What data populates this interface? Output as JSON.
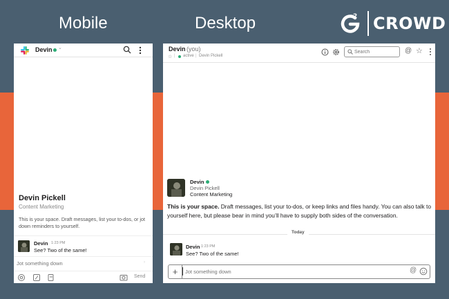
{
  "headings": {
    "mobile": "Mobile",
    "desktop": "Desktop"
  },
  "logo": {
    "text": "CROWD",
    "mark": "G",
    "superscript": "2"
  },
  "mobile": {
    "header": {
      "name": "Devin",
      "chevron": "⌄"
    },
    "intro": {
      "title": "Devin Pickell",
      "subtitle": "Content Marketing",
      "description": "This is your space. Draft messages, list your to-dos, or jot down reminders to yourself."
    },
    "message": {
      "author": "Devin",
      "time": "1:23 PM",
      "text": "See? Two of the same!"
    },
    "composer": {
      "placeholder": "Jot something down",
      "send_label": "Send"
    },
    "toolbar_icons": [
      "at-icon",
      "slash-icon",
      "attachment-icon",
      "image-icon"
    ]
  },
  "desktop": {
    "header": {
      "name": "Devin",
      "you": "(you)",
      "status": "active",
      "fullname": "Devin Pickell",
      "search_placeholder": "Search"
    },
    "profile": {
      "name": "Devin",
      "fullname": "Devin Pickell",
      "role": "Content Marketing"
    },
    "intro": {
      "bold": "This is your space.",
      "text": " Draft messages, list your to-dos, or keep links and files handy. You can also talk to yourself here, but please bear in mind you’ll have to supply both sides of the conversation."
    },
    "divider": "Today",
    "message": {
      "author": "Devin",
      "time": "1:23 PM",
      "text": "See? Two of the same!"
    },
    "composer": {
      "placeholder": "Jot something down",
      "plus": "+"
    }
  },
  "colors": {
    "band_blue": "#4a5f70",
    "band_orange": "#e8653a",
    "status_green": "#2bac76"
  }
}
